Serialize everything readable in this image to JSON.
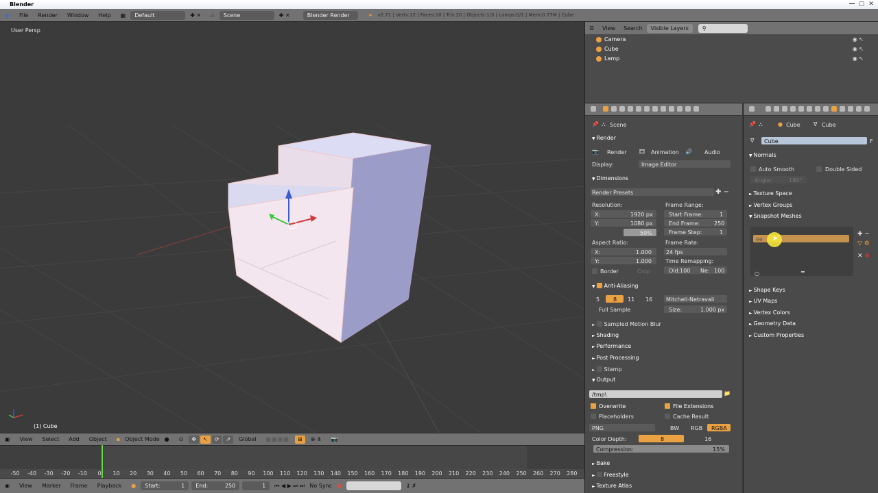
{
  "title": "Blender",
  "topbar": {
    "menus": [
      "File",
      "Render",
      "Window",
      "Help"
    ],
    "layout": "Default",
    "scene": "Scene",
    "engine": "Blender Render",
    "stats": "v2.71 | Verts:12 | Faces:10 | Tris:20 | Objects:1/3 | Lamps:0/1 | Mem:0.77M | Cube"
  },
  "viewport": {
    "view_label": "User Persp",
    "object_label": "(1) Cube",
    "header_menus": [
      "View",
      "Select",
      "Add",
      "Object"
    ],
    "mode": "Object Mode",
    "orientation": "Global"
  },
  "timeline": {
    "ticks": [
      "-50",
      "-40",
      "-30",
      "-20",
      "-10",
      "0",
      "10",
      "20",
      "30",
      "40",
      "50",
      "60",
      "70",
      "80",
      "90",
      "100",
      "110",
      "120",
      "130",
      "140",
      "150",
      "160",
      "170",
      "180",
      "190",
      "200",
      "210",
      "220",
      "230",
      "240",
      "250",
      "260",
      "270",
      "280"
    ],
    "menus": [
      "View",
      "Marker",
      "Frame",
      "Playback"
    ],
    "start_label": "Start:",
    "start": "1",
    "end_label": "End:",
    "end": "250",
    "current": "1",
    "sync": "No Sync"
  },
  "outliner": {
    "menus": [
      "View",
      "Search",
      "Visible Layers"
    ],
    "items": [
      "Camera",
      "Cube",
      "Lamp"
    ]
  },
  "render": {
    "context": "Scene",
    "render_label": "Render",
    "buttons": [
      "Render",
      "Animation",
      "Audio"
    ],
    "display_label": "Display:",
    "display": "Image Editor",
    "dimensions_label": "Dimensions",
    "render_presets": "Render Presets",
    "resolution_label": "Resolution:",
    "res_x_label": "X:",
    "res_x": "1920 px",
    "res_y_label": "Y:",
    "res_y": "1080 px",
    "res_pct": "50%",
    "aspect_label": "Aspect Ratio:",
    "aspect_x_label": "X:",
    "aspect_x": "1.000",
    "aspect_y_label": "Y:",
    "aspect_y": "1.000",
    "border": "Border",
    "crop": "Crop",
    "frame_range_label": "Frame Range:",
    "start_frame_label": "Start Frame:",
    "start_frame": "1",
    "end_frame_label": "End Frame:",
    "end_frame": "250",
    "frame_step_label": "Frame Step:",
    "frame_step": "1",
    "frame_rate_label": "Frame Rate:",
    "frame_rate": "24 fps",
    "time_remap_label": "Time Remapping:",
    "old_label": "Old:",
    "old": "100",
    "new_label": "Ne:",
    "new": "100",
    "aa_label": "Anti-Aliasing",
    "aa_samples": [
      "5",
      "8",
      "11",
      "16"
    ],
    "aa_filter": "Mitchell-Netravali",
    "full_sample": "Full Sample",
    "size_label": "Size:",
    "size": "1.000 px",
    "panels": [
      "Sampled Motion Blur",
      "Shading",
      "Performance",
      "Post Processing",
      "Stamp"
    ],
    "output_label": "Output",
    "output_path": "/tmp\\",
    "overwrite": "Overwrite",
    "file_ext": "File Extensions",
    "placeholders": "Placeholders",
    "cache_result": "Cache Result",
    "format": "PNG",
    "color_modes": [
      "BW",
      "RGB",
      "RGBA"
    ],
    "color_depth_label": "Color Depth:",
    "depths": [
      "8",
      "16"
    ],
    "compression_label": "Compression:",
    "compression": "15%",
    "panels_bottom": [
      "Bake",
      "Freestyle",
      "Texture Atlas"
    ]
  },
  "data_props": {
    "object_name": "Cube",
    "mesh_name": "Cube",
    "datablock": "Cube",
    "fake_user": "F",
    "normals_label": "Normals",
    "auto_smooth": "Auto Smooth",
    "double_sided": "Double Sided",
    "angle_label": "Angle:",
    "angle": "180°",
    "panels": [
      "Texture Space",
      "Vertex Groups"
    ],
    "snapshot_label": "Snapshot Meshes",
    "snapshot_item": "ee",
    "panels_bottom": [
      "Shape Keys",
      "UV Maps",
      "Vertex Colors",
      "Geometry Data",
      "Custom Properties"
    ]
  }
}
